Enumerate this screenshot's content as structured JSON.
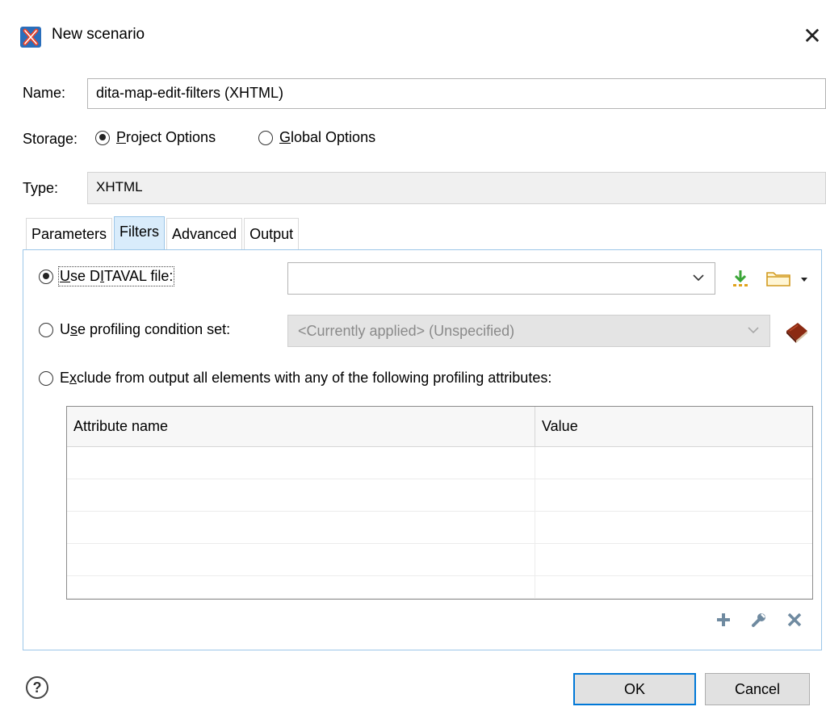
{
  "window": {
    "title": "New scenario"
  },
  "form": {
    "name_label": "Name:",
    "name_value": "dita-map-edit-filters (XHTML)",
    "storage_label": "Storage:",
    "storage_options": [
      {
        "label_pre": "",
        "label_u": "P",
        "label_post": "roject Options",
        "checked": true
      },
      {
        "label_pre": "",
        "label_u": "G",
        "label_post": "lobal Options",
        "checked": false
      }
    ],
    "type_label": "Type:",
    "type_value": "XHTML"
  },
  "tabs": [
    {
      "label": "Parameters",
      "active": false
    },
    {
      "label": "Filters",
      "active": true
    },
    {
      "label": "Advanced",
      "active": false
    },
    {
      "label": "Output",
      "active": false
    }
  ],
  "filters": {
    "ditaval": {
      "label_u": "U",
      "label_rest_pre": "se D",
      "label_u2": "I",
      "label_rest": "TAVAL file:",
      "checked": true,
      "value": ""
    },
    "profiling": {
      "label_pre": "U",
      "label_u": "s",
      "label_post": "e profiling condition set:",
      "checked": false,
      "value": "<Currently applied> (Unspecified)"
    },
    "exclude": {
      "label_pre": "E",
      "label_u": "x",
      "label_post": "clude from output all elements with any of the following profiling attributes:",
      "checked": false
    }
  },
  "table": {
    "columns": [
      "Attribute name",
      "Value"
    ],
    "rows": [
      [
        "",
        ""
      ],
      [
        "",
        ""
      ],
      [
        "",
        ""
      ],
      [
        "",
        ""
      ],
      [
        "",
        ""
      ]
    ]
  },
  "icons": {
    "app": "oxygen-x-icon",
    "close": "close-icon",
    "insert_editor_variables": "insert-variables-icon",
    "browse": "folder-icon",
    "profiling_book": "book-icon",
    "add": "add-icon",
    "edit": "wrench-icon",
    "remove": "remove-icon",
    "help": "help-icon"
  },
  "buttons": {
    "ok": "OK",
    "cancel": "Cancel"
  },
  "colors": {
    "accent": "#0078d7",
    "active_tab": "#d9ecfb"
  }
}
